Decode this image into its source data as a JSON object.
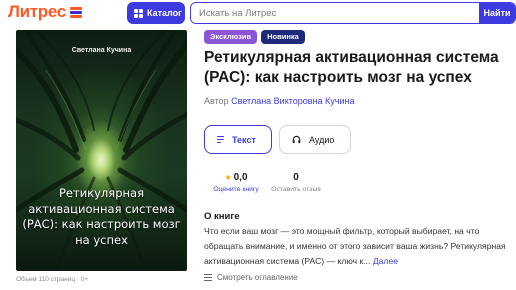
{
  "header": {
    "logo_text": "Литрес",
    "catalog_label": "Каталог",
    "search_placeholder": "Искать на Литрес",
    "search_button_label": "Найти",
    "brand_colors": {
      "orange": "#ff5a26",
      "blue": "#3d3bdf"
    }
  },
  "book": {
    "cover": {
      "author": "Светлана Кучина",
      "title": "Ретикулярная активационная система (РАС): как настроить мозг на успех"
    },
    "meta_line": "Объем 110 страниц · 0+",
    "badges": [
      {
        "label": "Эксклюзив",
        "color": "#8a55d6"
      },
      {
        "label": "Новинка",
        "color": "#1f2a7a"
      }
    ],
    "title": "Ретикулярная активационная система (РАС): как настроить мозг на успех",
    "author_prefix": "Автор",
    "author_name": "Светлана Викторовна Кучина",
    "formats": [
      {
        "label": "Текст",
        "icon": "text-lines-icon",
        "selected": true
      },
      {
        "label": "Аудио",
        "icon": "headphones-icon",
        "selected": false
      }
    ],
    "rating": {
      "value": "0,0",
      "label": "Оцените книгу"
    },
    "reviews": {
      "value": "0",
      "label": "Оставить отзыв"
    },
    "about": {
      "heading": "О книге",
      "text": "Что если ваш мозг — это мощный фильтр, который выбирает, на что обращать внимание, и именно от этого зависит ваша жизнь? Ретикулярная активационная система (РАС) — ключ к...",
      "more_link": "Далее"
    },
    "toc_link": "Смотреть оглавление"
  }
}
